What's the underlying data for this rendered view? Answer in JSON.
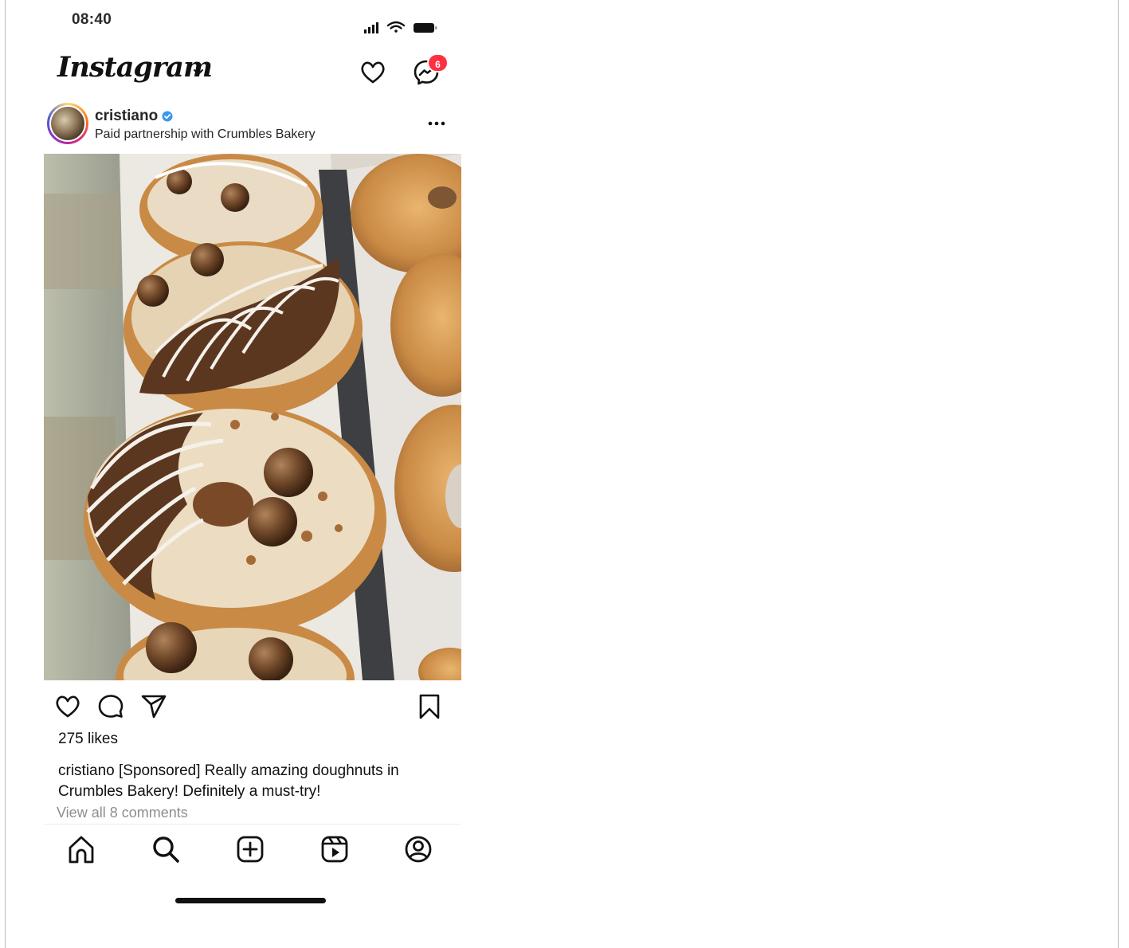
{
  "status_bar": {
    "time": "08:40"
  },
  "header": {
    "logo": "Instagram",
    "messages_badge": "6"
  },
  "post": {
    "username": "cristiano",
    "verified": true,
    "partnership_text": "Paid partnership with Crumbles Bakery",
    "likes": "275 likes",
    "caption_user": "cristiano",
    "caption_text": " [Sponsored] Really amazing doughnuts in Crumbles Bakery! Definitely a must-try!",
    "comments_link": "View all 8 comments"
  },
  "icons": {
    "header": [
      "instagram-logo",
      "chevron-down-icon",
      "heart-icon",
      "messenger-icon"
    ],
    "actions": [
      "heart-icon",
      "comment-icon",
      "share-icon",
      "bookmark-icon"
    ],
    "nav": [
      "home-icon",
      "search-icon",
      "create-icon",
      "reels-icon",
      "profile-icon"
    ]
  },
  "colors": {
    "badge": "#ff3040",
    "verified": "#3897f0",
    "muted_text": "#8e8e8e"
  }
}
